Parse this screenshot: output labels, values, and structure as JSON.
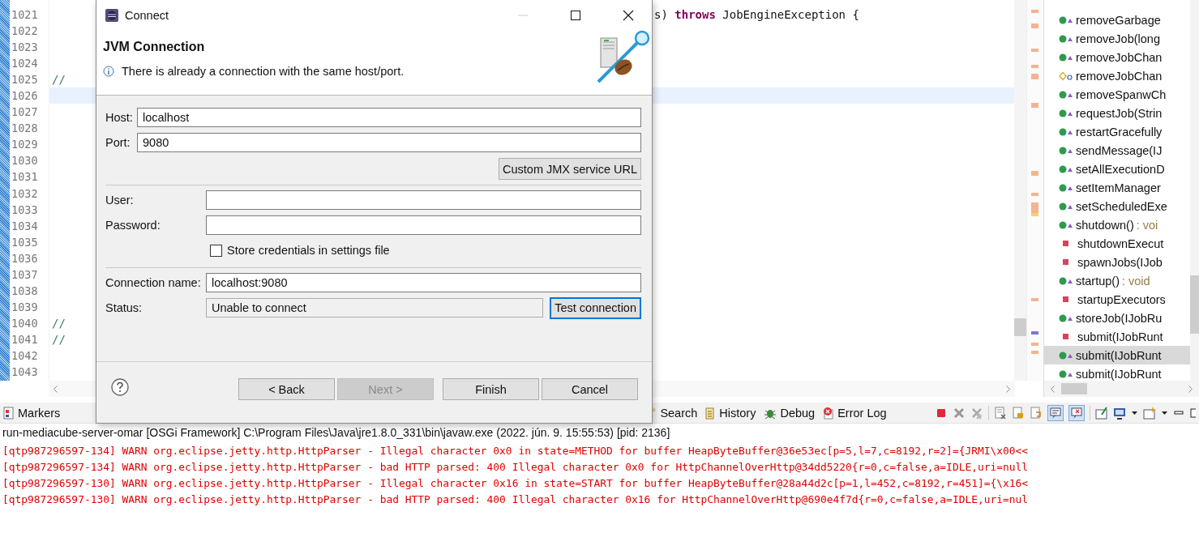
{
  "editor": {
    "lines": [
      {
        "number": "1021",
        "kind": "tail",
        "current": false,
        "segments": [
          {
            "text": "s) ",
            "keyword": false
          },
          {
            "text": "throws",
            "keyword": true
          },
          {
            "text": " JobEngineException {",
            "keyword": false
          }
        ]
      },
      {
        "number": "1022",
        "kind": "blank",
        "current": false
      },
      {
        "number": "1023",
        "kind": "blank",
        "current": false
      },
      {
        "number": "1024",
        "kind": "blank",
        "current": false
      },
      {
        "number": "1025",
        "kind": "comment",
        "current": false,
        "text": "//"
      },
      {
        "number": "1026",
        "kind": "blank",
        "current": true
      },
      {
        "number": "1027",
        "kind": "blank",
        "current": false
      },
      {
        "number": "1028",
        "kind": "blank",
        "current": false
      },
      {
        "number": "1029",
        "kind": "blank",
        "current": false
      },
      {
        "number": "1030",
        "kind": "blank",
        "current": false
      },
      {
        "number": "1031",
        "kind": "blank",
        "current": false
      },
      {
        "number": "1032",
        "kind": "blank",
        "current": false
      },
      {
        "number": "1033",
        "kind": "blank",
        "current": false
      },
      {
        "number": "1034",
        "kind": "blank",
        "current": false
      },
      {
        "number": "1035",
        "kind": "blank",
        "current": false
      },
      {
        "number": "1036",
        "kind": "blank",
        "current": false
      },
      {
        "number": "1037",
        "kind": "blank",
        "current": false
      },
      {
        "number": "1038",
        "kind": "blank",
        "current": false
      },
      {
        "number": "1039",
        "kind": "blank",
        "current": false
      },
      {
        "number": "1040",
        "kind": "comment",
        "current": false,
        "text": "//"
      },
      {
        "number": "1041",
        "kind": "comment",
        "current": false,
        "text": "//"
      },
      {
        "number": "1042",
        "kind": "blank",
        "current": false
      },
      {
        "number": "1043",
        "kind": "blank",
        "current": false
      }
    ]
  },
  "outline": {
    "items": [
      {
        "kind": "public",
        "name": "removeGarbage",
        "selected": false
      },
      {
        "kind": "public",
        "name": "removeJob(long",
        "selected": false
      },
      {
        "kind": "public",
        "name": "removeJobChan",
        "selected": false
      },
      {
        "kind": "default",
        "name": "removeJobChan",
        "selected": false
      },
      {
        "kind": "public",
        "name": "removeSpanwCh",
        "selected": false
      },
      {
        "kind": "public",
        "name": "requestJob(Strin",
        "selected": false
      },
      {
        "kind": "public",
        "name": "restartGracefully",
        "selected": false
      },
      {
        "kind": "public",
        "name": "sendMessage(IJ",
        "selected": false
      },
      {
        "kind": "public",
        "name": "setAllExecutionD",
        "selected": false
      },
      {
        "kind": "public",
        "name": "setItemManager",
        "selected": false
      },
      {
        "kind": "public",
        "name": "setScheduledExe",
        "selected": false
      },
      {
        "kind": "public",
        "name": "shutdown()",
        "type": ": voi",
        "selected": false
      },
      {
        "kind": "private",
        "name": "shutdownExecut",
        "selected": false
      },
      {
        "kind": "private",
        "name": "spawnJobs(IJob",
        "selected": false
      },
      {
        "kind": "public",
        "name": "startup()",
        "type": ": void",
        "selected": false
      },
      {
        "kind": "private",
        "name": "startupExecutors",
        "selected": false
      },
      {
        "kind": "public",
        "name": "storeJob(IJobRu",
        "selected": false
      },
      {
        "kind": "private",
        "name": "submit(IJobRunt",
        "selected": false
      },
      {
        "kind": "public",
        "name": "submit(IJobRunt",
        "selected": true
      },
      {
        "kind": "public",
        "name": "submit(IJobRunt",
        "selected": false
      }
    ]
  },
  "dialog": {
    "title": "Connect",
    "heading": "JVM Connection",
    "message": "There is already a connection with the same host/port.",
    "host_label": "Host:",
    "host": "localhost",
    "port_label": "Port:",
    "port": "9080",
    "custom_url_button": "Custom JMX service URL",
    "user_label": "User:",
    "password_label": "Password:",
    "store_credentials": {
      "label": "Store credentials in settings file",
      "checked": false
    },
    "name_label": "Connection name:",
    "name": "localhost:9080",
    "status_label": "Status:",
    "status": "Unable to connect",
    "test_button": "Test connection",
    "buttons": [
      {
        "label": "< Back",
        "disabled": false
      },
      {
        "label": "Next >",
        "disabled": true
      },
      {
        "label": "Finish",
        "disabled": false
      },
      {
        "label": "Cancel",
        "disabled": false
      }
    ]
  },
  "bottom_tabs": [
    {
      "kind": "markers",
      "label": "Markers"
    },
    {
      "kind": "gap"
    },
    {
      "kind": "search",
      "label": "Search"
    },
    {
      "kind": "history",
      "label": "History"
    },
    {
      "kind": "debug",
      "label": "Debug"
    },
    {
      "kind": "errorlog",
      "label": "Error Log"
    }
  ],
  "console_toggles": [
    {
      "selected": true
    },
    {
      "selected": true
    }
  ],
  "console": {
    "header": "run-mediacube-server-omar [OSGi Framework] C:\\Program Files\\Java\\jre1.8.0_331\\bin\\javaw.exe  (2022. jún. 9. 15:55:53) [pid: 2136]",
    "lines": [
      "[qtp987296597-134] WARN org.eclipse.jetty.http.HttpParser - Illegal character 0x0 in state=METHOD for buffer HeapByteBuffer@36e53ec[p=5,l=7,c=8192,r=2]={JRMI\\x00<<",
      "[qtp987296597-134] WARN org.eclipse.jetty.http.HttpParser - bad HTTP parsed: 400 Illegal character 0x0 for HttpChannelOverHttp@34dd5220{r=0,c=false,a=IDLE,uri=null",
      "[qtp987296597-130] WARN org.eclipse.jetty.http.HttpParser - Illegal character 0x16 in state=START for buffer HeapByteBuffer@28a44d2c[p=1,l=452,c=8192,r=451]={\\x16<",
      "[qtp987296597-130] WARN org.eclipse.jetty.http.HttpParser - bad HTTP parsed: 400 Illegal character 0x16 for HttpChannelOverHttp@690e4f7d{r=0,c=false,a=IDLE,uri=nul"
    ]
  }
}
